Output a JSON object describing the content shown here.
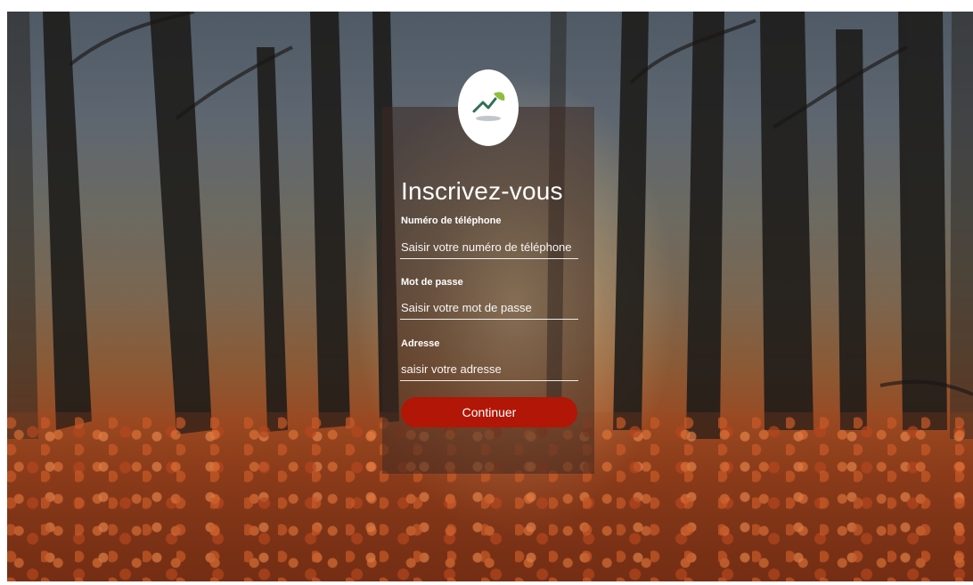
{
  "form": {
    "title": "Inscrivez-vous",
    "phone": {
      "label": "Numéro de téléphone",
      "placeholder": "Saisir votre numéro de téléphone"
    },
    "password": {
      "label": "Mot de passe",
      "placeholder": "Saisir votre mot de passe"
    },
    "address": {
      "label": "Adresse",
      "placeholder": "saisir votre adresse"
    },
    "submit_label": "Continuer"
  },
  "colors": {
    "button": "#b11606",
    "card_overlay": "rgba(60,40,32,0.55)",
    "logo_green": "#8cbf3b",
    "logo_dark": "#2f6f55"
  },
  "icons": {
    "logo": "mountain-leaf-logo"
  }
}
